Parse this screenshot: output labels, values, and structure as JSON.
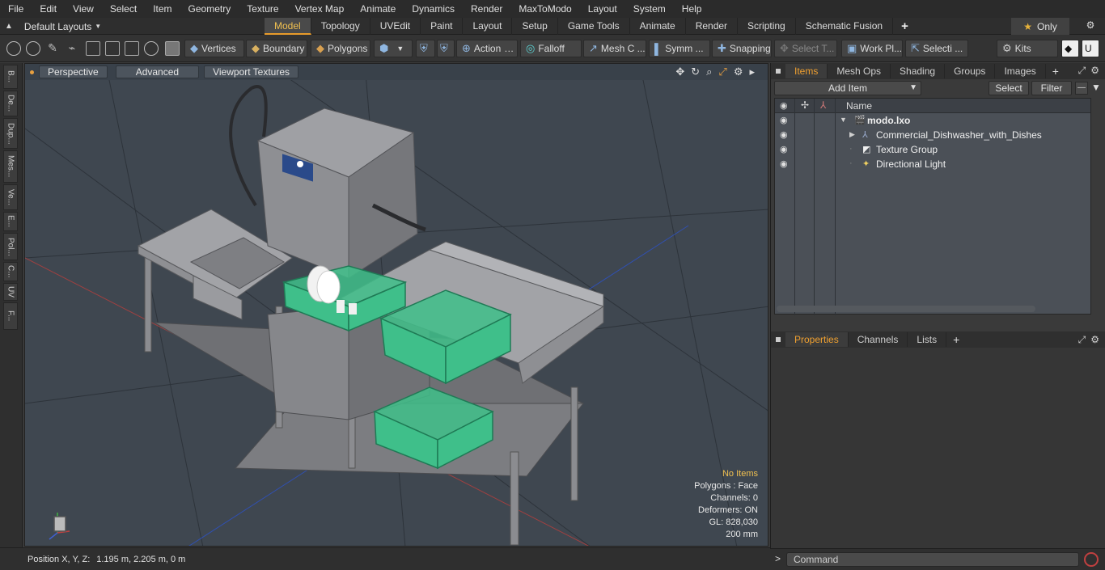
{
  "menubar": [
    "File",
    "Edit",
    "View",
    "Select",
    "Item",
    "Geometry",
    "Texture",
    "Vertex Map",
    "Animate",
    "Dynamics",
    "Render",
    "MaxToModo",
    "Layout",
    "System",
    "Help"
  ],
  "layouts_label": "Default Layouts",
  "tabs": [
    "Model",
    "Topology",
    "UVEdit",
    "Paint",
    "Layout",
    "Setup",
    "Game Tools",
    "Animate",
    "Render",
    "Scripting",
    "Schematic Fusion"
  ],
  "active_tab": "Model",
  "only_label": "Only",
  "toolbar": {
    "vertices": "Vertices",
    "boundary": "Boundary",
    "polygons": "Polygons",
    "action": "Action",
    "falloff": "Falloff",
    "meshc": "Mesh C ...",
    "symm": "Symm ...",
    "snapping": "Snapping",
    "selectt": "Select T...",
    "workpl": "Work Pl...",
    "selecti": "Selecti ...",
    "kits": "Kits"
  },
  "left_strip": [
    "B...",
    "De...",
    "Dup...",
    "Mes...",
    "Ve...",
    "E...",
    "Pol...",
    "C...",
    "UV",
    "F..."
  ],
  "viewport": {
    "perspective": "Perspective",
    "advanced": "Advanced",
    "viewport_textures": "Viewport Textures",
    "stats": {
      "no_items": "No Items",
      "polygons": "Polygons : Face",
      "channels": "Channels: 0",
      "deformers": "Deformers: ON",
      "gl": "GL: 828,030",
      "scale": "200 mm"
    }
  },
  "status": {
    "label": "Position X, Y, Z:",
    "value": "1.195 m, 2.205 m, 0 m"
  },
  "items_panel": {
    "tabs": [
      "Items",
      "Mesh Ops",
      "Shading",
      "Groups",
      "Images"
    ],
    "add_item": "Add Item",
    "select": "Select",
    "filter": "Filter",
    "name_col": "Name",
    "rows": [
      {
        "label": "modo.lxo"
      },
      {
        "label": "Commercial_Dishwasher_with_Dishes"
      },
      {
        "label": "Texture Group"
      },
      {
        "label": "Directional Light"
      }
    ]
  },
  "properties_panel": {
    "tabs": [
      "Properties",
      "Channels",
      "Lists"
    ]
  },
  "command": {
    "placeholder": "Command"
  },
  "colors": {
    "accent": "#e89b2a",
    "viewport_bg": "#3f4750",
    "rack_green": "#3fbf8a"
  }
}
